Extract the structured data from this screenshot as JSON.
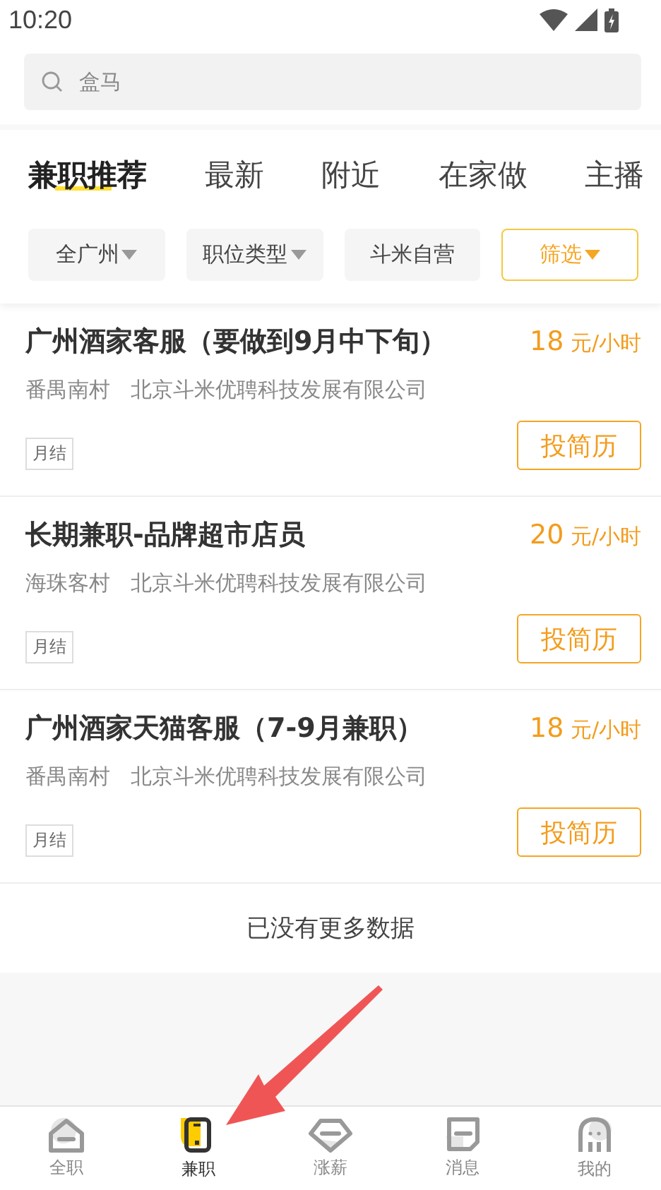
{
  "status_bar": {
    "time": "10:20"
  },
  "search": {
    "value": "盒马"
  },
  "tabs": [
    {
      "label": "兼职推荐",
      "selected": true
    },
    {
      "label": "最新",
      "selected": false
    },
    {
      "label": "附近",
      "selected": false
    },
    {
      "label": "在家做",
      "selected": false
    },
    {
      "label": "主播",
      "selected": false
    }
  ],
  "filters": [
    {
      "label": "全广州",
      "caret": true,
      "highlighted": false
    },
    {
      "label": "职位类型",
      "caret": true,
      "highlighted": false
    },
    {
      "label": "斗米自营",
      "caret": false,
      "highlighted": false
    },
    {
      "label": "筛选",
      "caret": true,
      "highlighted": true
    }
  ],
  "jobs": [
    {
      "title": "广州酒家客服（要做到9月中下旬）",
      "salary_amount": "18",
      "salary_unit": "元/小时",
      "location": "番禺南村",
      "company": "北京斗米优聘科技发展有限公司",
      "tag": "月结",
      "button": "投简历"
    },
    {
      "title": "长期兼职-品牌超市店员",
      "salary_amount": "20",
      "salary_unit": "元/小时",
      "location": "海珠客村",
      "company": "北京斗米优聘科技发展有限公司",
      "tag": "月结",
      "button": "投简历"
    },
    {
      "title": "广州酒家天猫客服（7-9月兼职）",
      "salary_amount": "18",
      "salary_unit": "元/小时",
      "location": "番禺南村",
      "company": "北京斗米优聘科技发展有限公司",
      "tag": "月结",
      "button": "投简历"
    }
  ],
  "end_text": "已没有更多数据",
  "bottom_nav": [
    {
      "label": "全职",
      "kind": "home",
      "selected": false
    },
    {
      "label": "兼职",
      "kind": "phone",
      "selected": true
    },
    {
      "label": "涨薪",
      "kind": "diamond",
      "selected": false
    },
    {
      "label": "消息",
      "kind": "message",
      "selected": false
    },
    {
      "label": "我的",
      "kind": "ghost",
      "selected": false
    }
  ]
}
